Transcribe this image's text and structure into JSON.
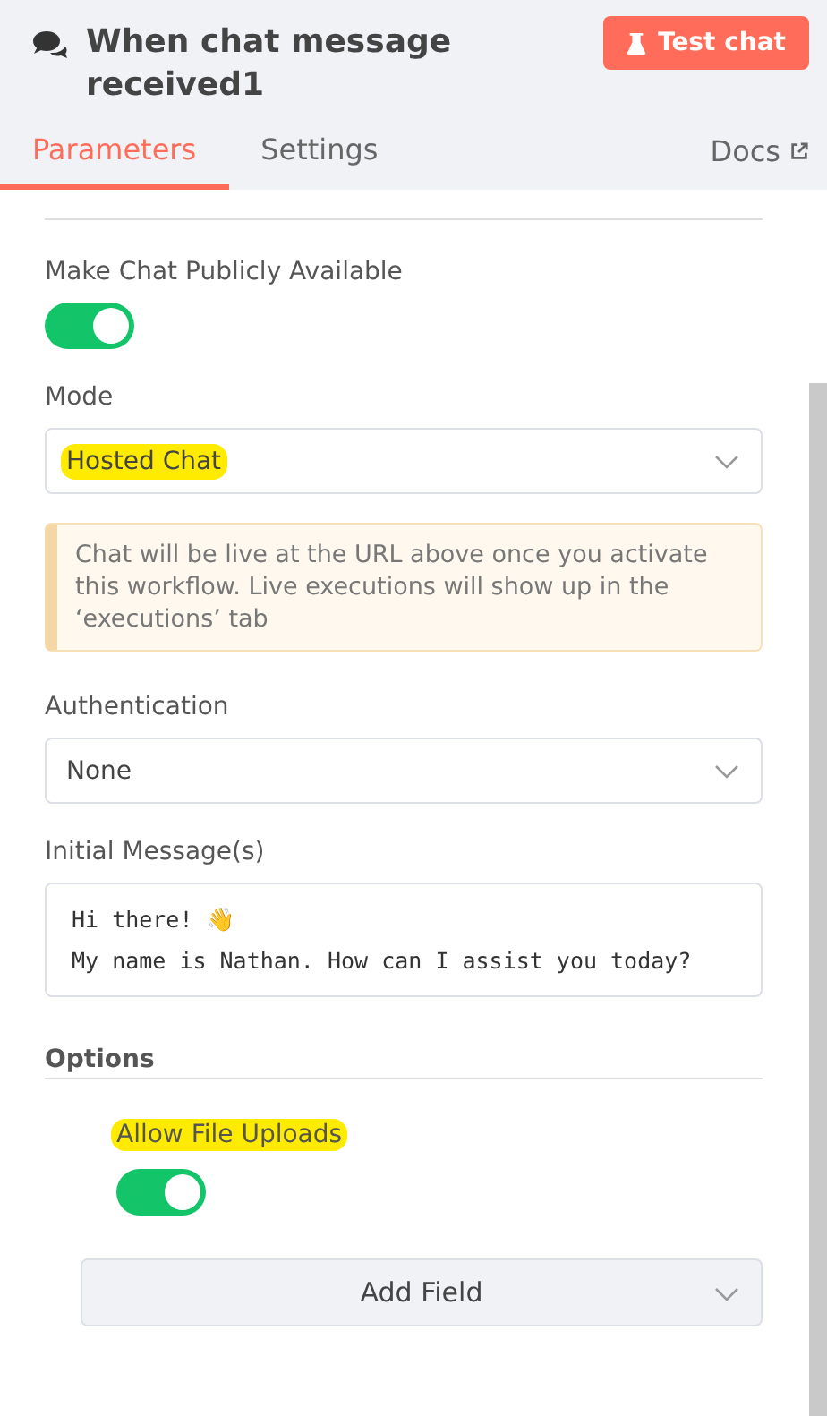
{
  "header": {
    "title": "When chat message received1",
    "test_button": "Test chat"
  },
  "tabs": [
    {
      "label": "Parameters",
      "selected": true
    },
    {
      "label": "Settings",
      "selected": false
    }
  ],
  "docs_link": "Docs",
  "parameters": [
    {
      "kind": "toggle",
      "label": "Make Chat Publicly Available",
      "on": true
    },
    {
      "kind": "select",
      "label": "Mode",
      "value": "Hosted Chat",
      "highlighted": true
    },
    {
      "kind": "notice",
      "text": "Chat will be live at the URL above once you activate this workflow. Live executions will show up in the ‘executions’ tab"
    },
    {
      "kind": "select",
      "label": "Authentication",
      "value": "None",
      "highlighted": false
    },
    {
      "kind": "textarea",
      "label": "Initial Message(s)",
      "value": "Hi there! 👋\nMy name is Nathan. How can I assist you today?"
    }
  ],
  "options": {
    "title": "Options",
    "items": [
      {
        "label": "Allow File Uploads",
        "on": true,
        "highlighted": true
      }
    ],
    "add_button": "Add Field"
  }
}
